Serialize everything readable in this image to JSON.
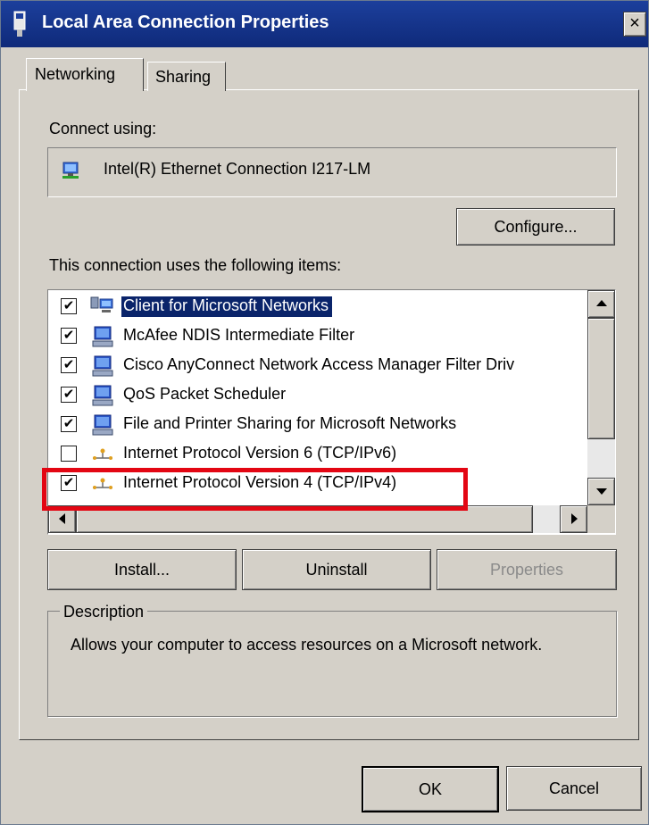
{
  "window": {
    "title": "Local Area Connection Properties",
    "close_glyph": "×"
  },
  "tabs": [
    {
      "label": "Networking"
    },
    {
      "label": "Sharing"
    }
  ],
  "connect_using": {
    "label": "Connect using:",
    "adapter": "Intel(R) Ethernet Connection I217-LM",
    "configure_button": "Configure..."
  },
  "items_section": {
    "label": "This connection uses the following items:",
    "items": [
      {
        "label": "Client for Microsoft Networks",
        "checked": true,
        "selected": true,
        "icon": "network-client-icon"
      },
      {
        "label": "McAfee NDIS Intermediate Filter",
        "checked": true,
        "selected": false,
        "icon": "network-service-icon"
      },
      {
        "label": "Cisco AnyConnect Network Access Manager Filter Driv",
        "checked": true,
        "selected": false,
        "icon": "network-service-icon"
      },
      {
        "label": "QoS Packet Scheduler",
        "checked": true,
        "selected": false,
        "icon": "network-service-icon"
      },
      {
        "label": "File and Printer Sharing for Microsoft Networks",
        "checked": true,
        "selected": false,
        "icon": "network-service-icon"
      },
      {
        "label": "Internet Protocol Version 6 (TCP/IPv6)",
        "checked": false,
        "selected": false,
        "icon": "protocol-icon"
      },
      {
        "label": "Internet Protocol Version 4 (TCP/IPv4)",
        "checked": true,
        "selected": false,
        "icon": "protocol-icon"
      }
    ]
  },
  "buttons": {
    "install": "Install...",
    "uninstall": "Uninstall",
    "properties": "Properties",
    "ok": "OK",
    "cancel": "Cancel"
  },
  "description": {
    "title": "Description",
    "text": "Allows your computer to access resources on a Microsoft network."
  },
  "checkmark_glyph": "✔",
  "colors": {
    "titlebar": "#1c3f9c",
    "selection": "#0a246a",
    "highlight": "#e30613",
    "face": "#d4d0c8"
  }
}
